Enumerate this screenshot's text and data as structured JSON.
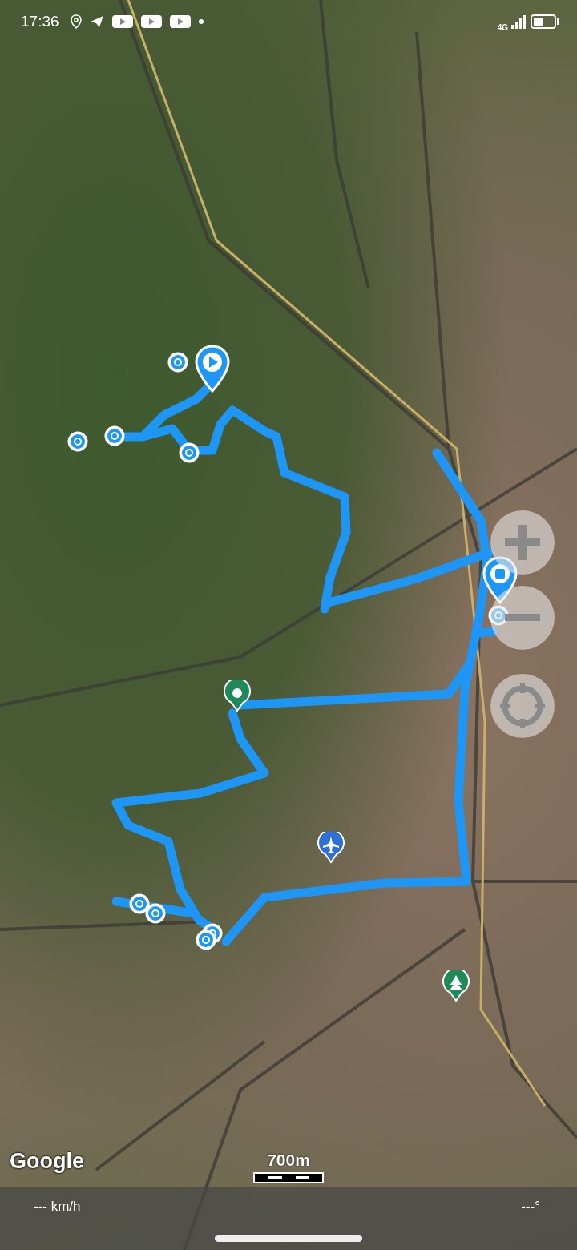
{
  "status_bar": {
    "time": "17:36",
    "network": "4G"
  },
  "map": {
    "attribution": "Google",
    "scale": "700m"
  },
  "info_bar": {
    "speed": "--- km/h",
    "heading": "---°"
  }
}
